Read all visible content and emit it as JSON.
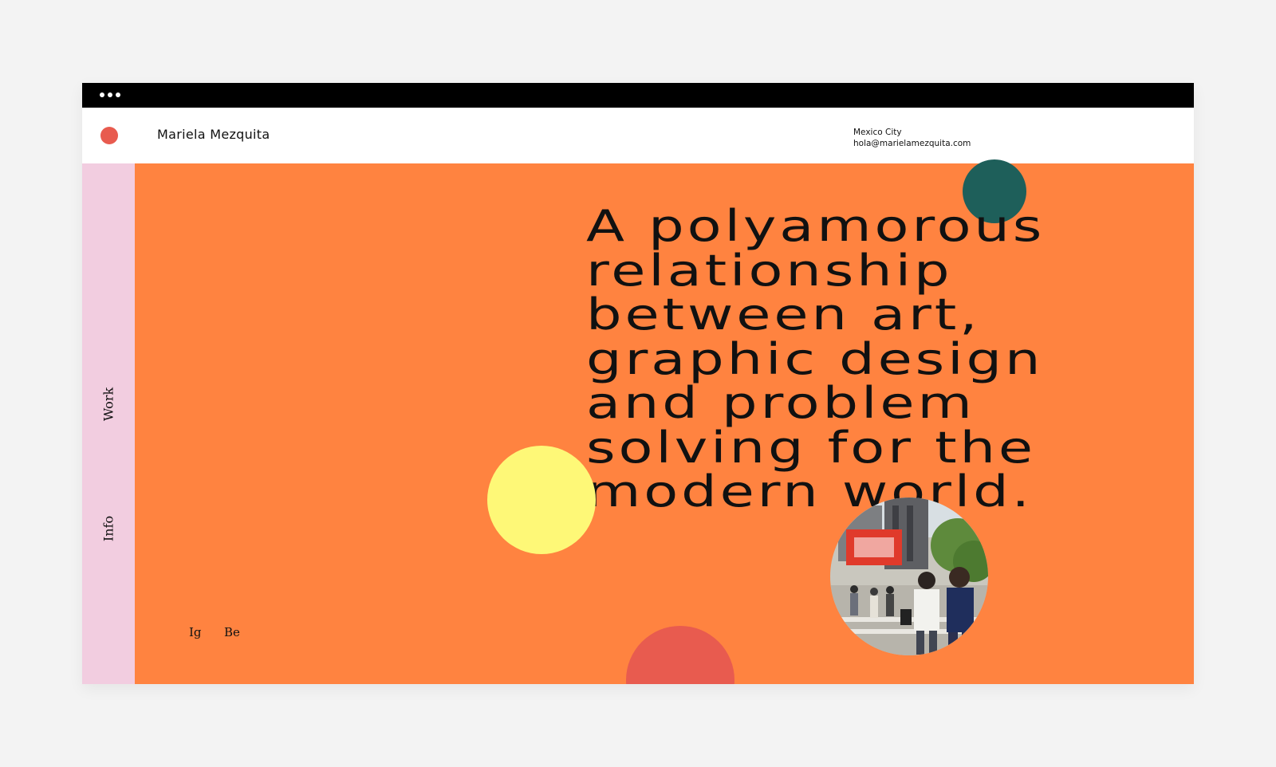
{
  "site": {
    "name": "Mariela Mezquita",
    "city": "Mexico City",
    "email": "hola@marielamezquita.com"
  },
  "sidebar": {
    "items": [
      {
        "label": "Work"
      },
      {
        "label": "Info"
      }
    ]
  },
  "hero": {
    "text": "A polyamorous\nrelationship\nbetween art,\ngraphic design\nand problem\nsolving for the\nmodern world."
  },
  "social": {
    "links": [
      {
        "label": "Ig"
      },
      {
        "label": "Be"
      }
    ]
  },
  "colors": {
    "page_bg": "#f3f3f3",
    "titlebar": "#000000",
    "header_bg": "#ffffff",
    "sidebar_bg": "#f2cde0",
    "hero_bg": "#ff8340",
    "logo_dot": "#e85b4f",
    "teal_circle": "#1e5f5a",
    "yellow_circle": "#fef877",
    "red_circle": "#e85b4f"
  },
  "icons": {
    "window_controls": "three-dots-icon",
    "logo": "red-circle-logo-icon",
    "photo": "street-crossing-photo"
  }
}
